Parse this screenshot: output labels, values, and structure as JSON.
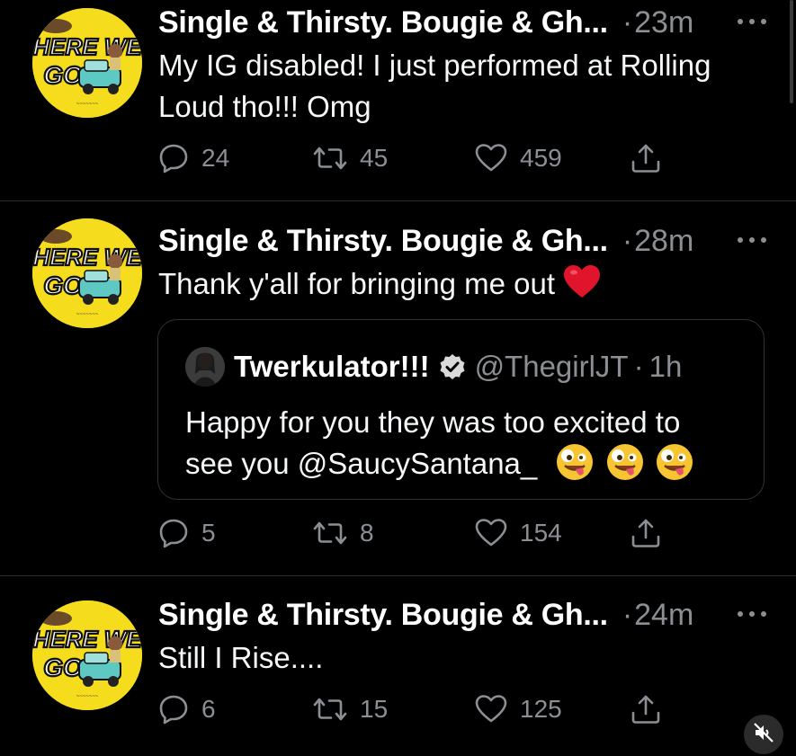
{
  "colors": {
    "background": "#000000",
    "text": "#ffffff",
    "muted": "#8b8f94",
    "avatar_yellow": "#f5dc1d",
    "heart_red": "#e0152b",
    "divider": "#2b2f33"
  },
  "avatar": {
    "logo_text_line1": "HERE WE",
    "logo_text_line2": "GO"
  },
  "tweets": [
    {
      "display_name": "Single & Thirsty. Bougie & Gh...",
      "separator": "·",
      "time": "23m",
      "text_line1": "My IG disabled! I just performed at Rolling",
      "text_line2": "Loud tho!!! Omg",
      "replies": "24",
      "retweets": "45",
      "likes": "459"
    },
    {
      "display_name": "Single & Thirsty. Bougie & Gh...",
      "separator": "·",
      "time": "28m",
      "text": "Thank y'all for bringing me out",
      "emoji": "red-heart",
      "quoted": {
        "name": "Twerkulator!!!",
        "handle": "@ThegirlJT",
        "separator": "·",
        "time": "1h",
        "text_line1": "Happy for you they was too excited to",
        "text_line2": "see you @SaucySantana_",
        "emojis": [
          "zany-face",
          "zany-face",
          "zany-face"
        ]
      },
      "replies": "5",
      "retweets": "8",
      "likes": "154"
    },
    {
      "display_name": "Single & Thirsty. Bougie & Gh...",
      "separator": "·",
      "time": "24m",
      "text": "Still I Rise....",
      "replies": "6",
      "retweets": "15",
      "likes": "125"
    }
  ],
  "icons": {
    "reply": "reply-icon",
    "retweet": "retweet-icon",
    "like": "heart-outline-icon",
    "share": "share-icon",
    "more": "more-dots-icon",
    "mute": "muted-speaker-icon"
  }
}
